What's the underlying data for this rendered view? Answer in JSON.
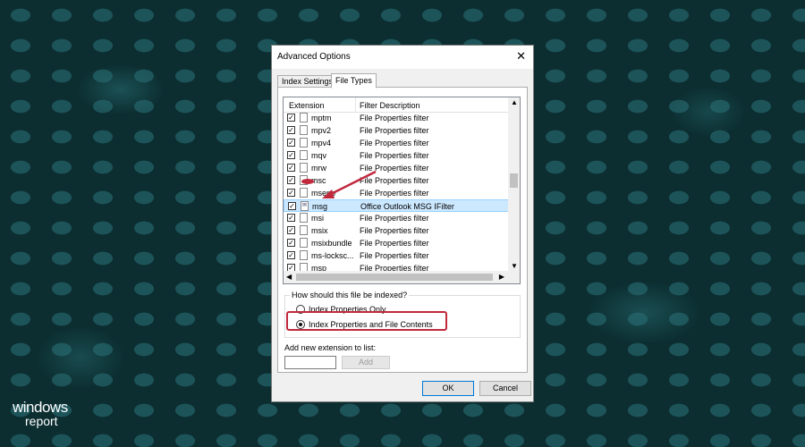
{
  "window": {
    "title": "Advanced Options",
    "close_glyph": "✕"
  },
  "tabs": [
    {
      "label": "Index Settings"
    },
    {
      "label": "File Types"
    }
  ],
  "table": {
    "headers": {
      "extension": "Extension",
      "description": "Filter Description"
    },
    "rows": [
      {
        "ext": "mptm",
        "desc": "File Properties filter",
        "checked": true
      },
      {
        "ext": "mpv2",
        "desc": "File Properties filter",
        "checked": true
      },
      {
        "ext": "mpv4",
        "desc": "File Properties filter",
        "checked": true
      },
      {
        "ext": "mqv",
        "desc": "File Properties filter",
        "checked": true
      },
      {
        "ext": "mrw",
        "desc": "File Properties filter",
        "checked": true
      },
      {
        "ext": "msc",
        "desc": "File Properties filter",
        "checked": true
      },
      {
        "ext": "msepb",
        "desc": "File Properties filter",
        "checked": true
      },
      {
        "ext": "msg",
        "desc": "Office Outlook MSG IFilter",
        "checked": true,
        "selected": true
      },
      {
        "ext": "msi",
        "desc": "File Properties filter",
        "checked": true
      },
      {
        "ext": "msix",
        "desc": "File Properties filter",
        "checked": true
      },
      {
        "ext": "msixbundle",
        "desc": "File Properties filter",
        "checked": true
      },
      {
        "ext": "ms-locksc...",
        "desc": "File Properties filter",
        "checked": true
      },
      {
        "ext": "msp",
        "desc": "File Properties filter",
        "checked": true
      }
    ]
  },
  "indexing": {
    "legend": "How should this file be indexed?",
    "options": [
      {
        "label": "Index Properties Only",
        "selected": false
      },
      {
        "label": "Index Properties and File Contents",
        "selected": true
      }
    ]
  },
  "add_extension": {
    "label": "Add new extension to list:",
    "value": "",
    "button": "Add"
  },
  "buttons": {
    "ok": "OK",
    "cancel": "Cancel"
  },
  "watermark": {
    "line1": "windows",
    "line2": "report"
  },
  "colors": {
    "highlight": "#c0283c",
    "selection": "#cce8ff",
    "background": "#0c2e31"
  }
}
